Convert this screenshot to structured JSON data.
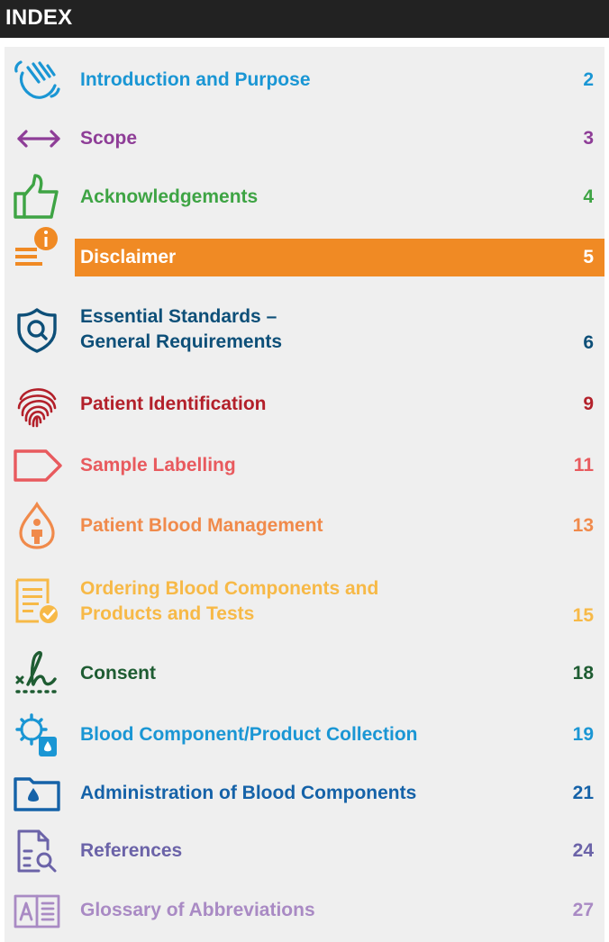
{
  "header": {
    "title": "INDEX"
  },
  "colors": {
    "header_bg": "#222222",
    "panel_bg": "#efefef",
    "highlight_bg": "#f08a24"
  },
  "entries": [
    {
      "label": "Introduction and Purpose",
      "page": "2",
      "color": "#1a96d4",
      "icon": "waving-hand-icon"
    },
    {
      "label": "Scope",
      "page": "3",
      "color": "#8e3d97",
      "icon": "double-arrow-icon"
    },
    {
      "label": "Acknowledgements",
      "page": "4",
      "color": "#3ea444",
      "icon": "thumbs-up-icon"
    },
    {
      "label": "Disclaimer",
      "page": "5",
      "color": "#ffffff",
      "icon": "info-alert-icon",
      "highlighted": true
    },
    {
      "label_line1": "Essential Standards –",
      "label_line2": "General Requirements",
      "page": "6",
      "color": "#0d4f78",
      "icon": "shield-search-icon"
    },
    {
      "label": "Patient Identification",
      "page": "9",
      "color": "#b3202a",
      "icon": "fingerprint-icon"
    },
    {
      "label": "Sample Labelling",
      "page": "11",
      "color": "#e85a5e",
      "icon": "tag-label-icon"
    },
    {
      "label": "Patient Blood Management",
      "page": "13",
      "color": "#f08a4b",
      "icon": "blood-drop-person-icon"
    },
    {
      "label_line1": "Ordering Blood Components and",
      "label_line2": "Products and Tests",
      "page": "15",
      "color": "#f7b947",
      "icon": "order-form-check-icon"
    },
    {
      "label": "Consent",
      "page": "18",
      "color": "#1e5c32",
      "icon": "signature-icon"
    },
    {
      "label": "Blood Component/Product Collection",
      "page": "19",
      "color": "#1a96d4",
      "icon": "gear-blood-bag-icon"
    },
    {
      "label": "Administration of Blood Components",
      "page": "21",
      "color": "#1562a8",
      "icon": "folder-drop-icon"
    },
    {
      "label": "References",
      "page": "24",
      "color": "#6b63a8",
      "icon": "document-search-icon"
    },
    {
      "label": "Glossary of Abbreviations",
      "page": "27",
      "color": "#a98ac4",
      "icon": "book-glossary-icon"
    }
  ]
}
